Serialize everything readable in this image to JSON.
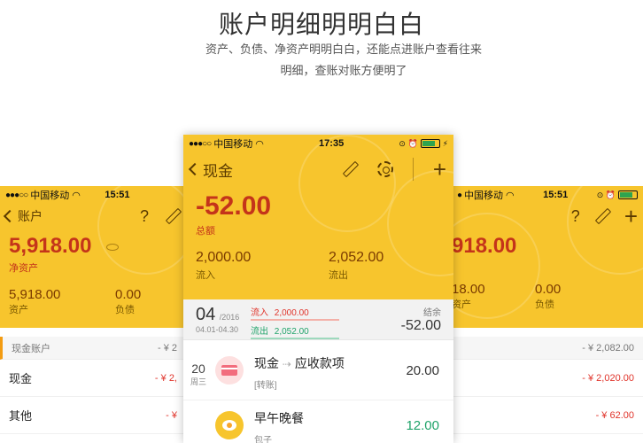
{
  "hero": {
    "title": "账户明细明明白白",
    "subtitle": "资产、负债、净资产明明白白，还能点进账户查看往来明细，查账对账方便明了"
  },
  "left_phone": {
    "carrier": "中国移动",
    "time": "15:51",
    "nav_title": "账户",
    "net_amount": "5,918.00",
    "net_label": "净资产",
    "assets_value": "5,918.00",
    "assets_label": "资产",
    "debt_value": "0.00",
    "debt_label": "负债",
    "section_title": "现金账户",
    "section_value": "- ¥ 2",
    "rows": [
      {
        "name": "现金",
        "amount": "- ¥ 2,"
      },
      {
        "name": "其他",
        "amount": "- ¥"
      }
    ]
  },
  "center_phone": {
    "carrier": "中国移动",
    "time": "17:35",
    "nav_title": "现金",
    "total_amount": "-52.00",
    "total_label": "总额",
    "inflow_value": "2,000.00",
    "inflow_label": "流入",
    "outflow_value": "2,052.00",
    "outflow_label": "流出",
    "period": {
      "day": "04",
      "year": "/2016",
      "range": "04.01-04.30",
      "in_label": "流入",
      "in_value": "2,000.00",
      "out_label": "流出",
      "out_value": "2,052.00",
      "balance_label": "结余",
      "balance_value": "-52.00"
    },
    "entries": [
      {
        "day": "20",
        "weekday": "周三",
        "from": "现金",
        "to": "应收款项",
        "note": "[转账]",
        "amount": "20.00"
      },
      {
        "title": "早午晚餐",
        "note": "包子",
        "amount": "12.00"
      }
    ]
  },
  "right_phone": {
    "carrier": "中国移动",
    "time": "15:51",
    "net_amount": "918.00",
    "assets_value": "18.00",
    "assets_label": "资产",
    "debt_value": "0.00",
    "debt_label": "负债",
    "section_value": "- ¥ 2,082.00",
    "rows": [
      {
        "amount": "- ¥ 2,020.00"
      },
      {
        "amount": "- ¥ 62.00"
      }
    ]
  },
  "colors": {
    "brand_yellow": "#f7c52d",
    "negative": "#e0332a",
    "positive": "#20a36a"
  }
}
